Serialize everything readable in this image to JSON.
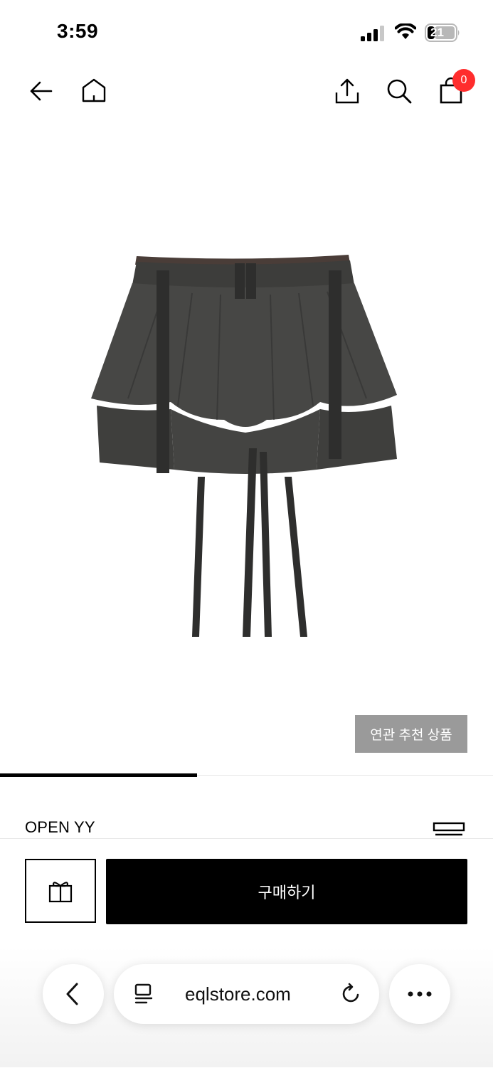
{
  "status_bar": {
    "time": "3:59",
    "battery": "21"
  },
  "header": {
    "cart_count": "0",
    "icons": [
      "back-arrow-icon",
      "home-icon",
      "share-icon",
      "search-icon",
      "shopping-bag-icon"
    ]
  },
  "product": {
    "related_label": "연관 추천 상품",
    "brand": "OPEN YY",
    "image_progress": 0.4
  },
  "purchase": {
    "buy_label": "구매하기",
    "gift_icon": "gift-icon"
  },
  "browser": {
    "url": "eqlstore.com",
    "icons": [
      "chevron-left-icon",
      "reader-icon",
      "reload-icon",
      "more-icon"
    ]
  }
}
